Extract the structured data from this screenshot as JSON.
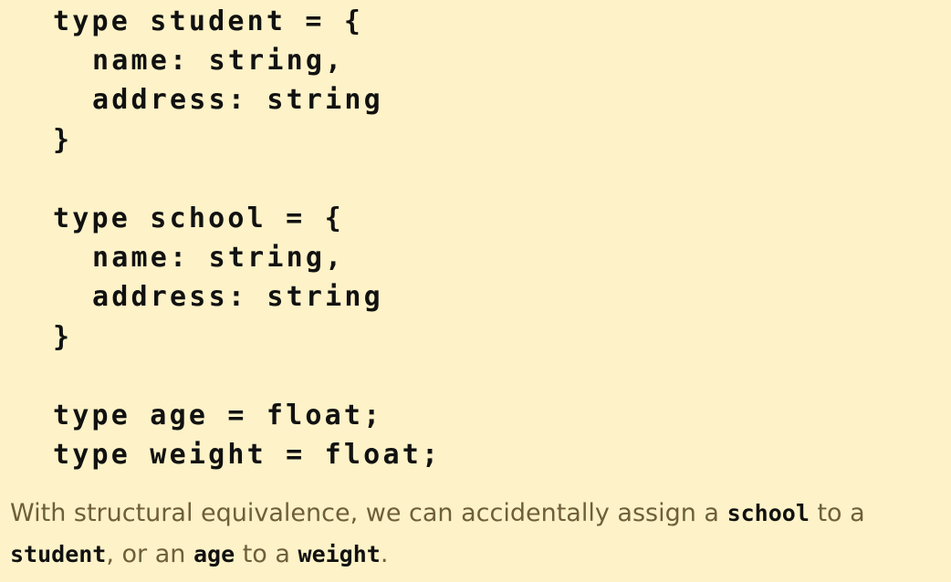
{
  "code": {
    "student_open": "type student = {",
    "student_name": "name: string,",
    "student_address": "address: string",
    "student_close": "}",
    "school_open": "type school = {",
    "school_name": "name: string,",
    "school_address": "address: string",
    "school_close": "}",
    "age_line": "type age = float;",
    "weight_line": "type weight = float;"
  },
  "text": {
    "part1": "With structural equivalence, we can accidentally assign a ",
    "code1": "school",
    "part2": " to a ",
    "code2": "student",
    "part3": ", or an ",
    "code3": "age",
    "part4": " to a ",
    "code4": "weight",
    "part5": "."
  }
}
